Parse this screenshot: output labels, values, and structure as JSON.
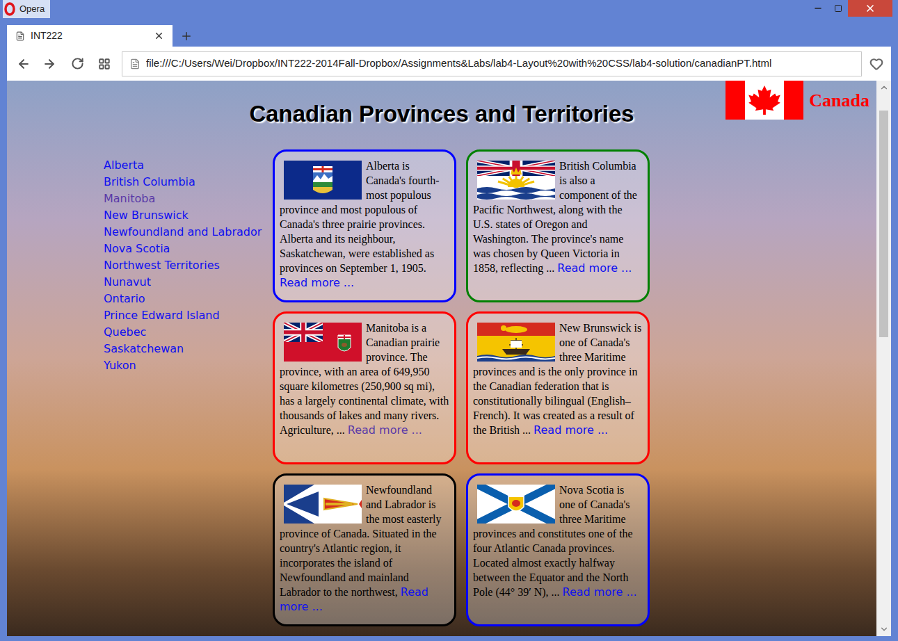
{
  "window": {
    "title": "Opera"
  },
  "tabs": [
    {
      "label": "INT222",
      "selected": true
    }
  ],
  "address_bar": {
    "url": "file:///C:/Users/Wei/Dropbox/INT222-2014Fall-Dropbox/Assignments&Labs/lab4-Layout%20with%20CSS/lab4-solution/canadianPT.html"
  },
  "page": {
    "brand": "Canada",
    "heading": "Canadian Provinces and Territories",
    "nav": [
      {
        "label": "Alberta",
        "visited": false
      },
      {
        "label": "British Columbia",
        "visited": false
      },
      {
        "label": "Manitoba",
        "visited": true
      },
      {
        "label": "New Brunswick",
        "visited": false
      },
      {
        "label": "Newfoundland and Labrador",
        "visited": false
      },
      {
        "label": "Nova Scotia",
        "visited": false
      },
      {
        "label": "Northwest Territories",
        "visited": false
      },
      {
        "label": "Nunavut",
        "visited": false
      },
      {
        "label": "Ontario",
        "visited": false
      },
      {
        "label": "Prince Edward Island",
        "visited": false
      },
      {
        "label": "Quebec",
        "visited": false
      },
      {
        "label": "Saskatchewan",
        "visited": false
      },
      {
        "label": "Yukon",
        "visited": false
      }
    ],
    "cards": [
      {
        "kind": "alberta",
        "color": "#0000ff",
        "text": "Alberta is Canada's fourth-most populous province and most populous of Canada's three prairie provinces. Alberta and its neighbour, Saskatchewan, were established as provinces on September 1, 1905.",
        "link": "Read more ...",
        "link_visited": false
      },
      {
        "kind": "british-columbia",
        "color": "#008000",
        "text": "British Columbia is also a component of the Pacific Northwest, along with the U.S. states of Oregon and Washington. The province's name was chosen by Queen Victoria in 1858, reflecting ...",
        "link": "Read more ...",
        "link_visited": false
      },
      {
        "kind": "manitoba",
        "color": "#ff0000",
        "text": "Manitoba is a Canadian prairie province. The province, with an area of 649,950 square kilometres (250,900 sq mi), has a largely continental climate, with thousands of lakes and many rivers. Agriculture, ...",
        "link": "Read more ...",
        "link_visited": true
      },
      {
        "kind": "new-brunswick",
        "color": "#ff0000",
        "text": "New Brunswick is one of Canada's three Maritime provinces and is the only province in the Canadian federation that is constitutionally bilingual (English–French). It was created as a result of the British ...",
        "link": "Read more ...",
        "link_visited": false
      },
      {
        "kind": "newfoundland",
        "color": "#000000",
        "text": "Newfoundland and Labrador is the most easterly province of Canada. Situated in the country's Atlantic region, it incorporates the island of Newfoundland and mainland Labrador to the northwest,",
        "link": "Read more ...",
        "link_visited": false
      },
      {
        "kind": "nova-scotia",
        "color": "#0000ff",
        "text": "Nova Scotia is one of Canada's three Maritime provinces and constitutes one of the four Atlantic Canada provinces. Located almost exactly halfway between the Equator and the North Pole (44° 39′ N), ...",
        "link": "Read more ...",
        "link_visited": false
      }
    ]
  },
  "scrollbar": {
    "offset": 0.03,
    "level": 0.43
  }
}
